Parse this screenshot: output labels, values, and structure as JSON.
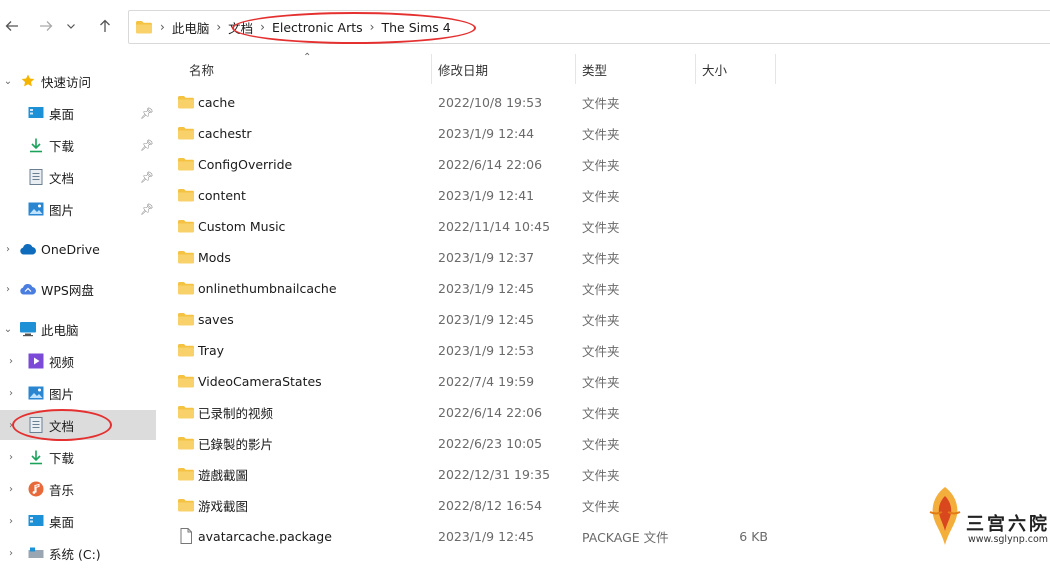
{
  "nav": {
    "back_icon": "arrow-left-icon",
    "forward_icon": "arrow-right-icon",
    "dropdown_icon": "chevron-down-icon",
    "up_icon": "arrow-up-icon"
  },
  "address": {
    "folder_icon": "folder-icon",
    "crumbs": [
      "此电脑",
      "文档",
      "Electronic Arts",
      "The Sims 4"
    ]
  },
  "sidebar": {
    "quick_access": "快速访问",
    "desktop": "桌面",
    "downloads": "下载",
    "documents": "文档",
    "pictures": "图片",
    "onedrive": "OneDrive",
    "wps": "WPS网盘",
    "this_pc": "此电脑",
    "videos": "视频",
    "pictures2": "图片",
    "documents2": "文档",
    "downloads2": "下载",
    "music": "音乐",
    "desktop2": "桌面",
    "system_drive": "系统 (C:)"
  },
  "columns": {
    "name": "名称",
    "date": "修改日期",
    "type": "类型",
    "size": "大小"
  },
  "files": [
    {
      "name": "cache",
      "date": "2022/10/8 19:53",
      "type": "文件夹",
      "size": "",
      "icon": "folder-icon"
    },
    {
      "name": "cachestr",
      "date": "2023/1/9 12:44",
      "type": "文件夹",
      "size": "",
      "icon": "folder-icon"
    },
    {
      "name": "ConfigOverride",
      "date": "2022/6/14 22:06",
      "type": "文件夹",
      "size": "",
      "icon": "folder-icon"
    },
    {
      "name": "content",
      "date": "2023/1/9 12:41",
      "type": "文件夹",
      "size": "",
      "icon": "folder-icon"
    },
    {
      "name": "Custom Music",
      "date": "2022/11/14 10:45",
      "type": "文件夹",
      "size": "",
      "icon": "folder-icon"
    },
    {
      "name": "Mods",
      "date": "2023/1/9 12:37",
      "type": "文件夹",
      "size": "",
      "icon": "folder-icon"
    },
    {
      "name": "onlinethumbnailcache",
      "date": "2023/1/9 12:45",
      "type": "文件夹",
      "size": "",
      "icon": "folder-icon"
    },
    {
      "name": "saves",
      "date": "2023/1/9 12:45",
      "type": "文件夹",
      "size": "",
      "icon": "folder-icon"
    },
    {
      "name": "Tray",
      "date": "2023/1/9 12:53",
      "type": "文件夹",
      "size": "",
      "icon": "folder-icon"
    },
    {
      "name": "VideoCameraStates",
      "date": "2022/7/4 19:59",
      "type": "文件夹",
      "size": "",
      "icon": "folder-icon"
    },
    {
      "name": "已录制的视频",
      "date": "2022/6/14 22:06",
      "type": "文件夹",
      "size": "",
      "icon": "folder-icon"
    },
    {
      "name": "已錄製的影片",
      "date": "2022/6/23 10:05",
      "type": "文件夹",
      "size": "",
      "icon": "folder-icon"
    },
    {
      "name": "遊戲截圖",
      "date": "2022/12/31 19:35",
      "type": "文件夹",
      "size": "",
      "icon": "folder-icon"
    },
    {
      "name": "游戏截图",
      "date": "2022/8/12 16:54",
      "type": "文件夹",
      "size": "",
      "icon": "folder-icon"
    },
    {
      "name": "avatarcache.package",
      "date": "2023/1/9 12:45",
      "type": "PACKAGE 文件",
      "size": "6 KB",
      "icon": "file-icon"
    }
  ],
  "watermark": {
    "text": "三宫六院",
    "url": "www.sglynp.com"
  },
  "colors": {
    "folder": "#f5c242",
    "selected": "#dcdcdc",
    "annotation": "#e53030",
    "accent": "#0067c0"
  }
}
